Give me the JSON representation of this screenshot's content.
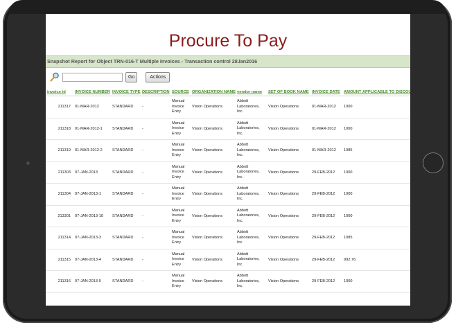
{
  "header": {
    "title": "Procure To Pay"
  },
  "report": {
    "title": "Snapshot Report for Object TRN-016-T Multiple invoices - Transaction control 28Jan2016"
  },
  "toolbar": {
    "go_label": "Go",
    "actions_label": "Actions"
  },
  "table": {
    "columns": [
      "invoice id",
      "INVOICE NUMBER",
      "INVOICE TYPE",
      "DESCRIPTION",
      "SOURCE",
      "ORGANIZATION NAME",
      "vendor name",
      "SET OF BOOK NAME",
      "INVOICE DATE",
      "AMOUNT APPLICABLE TO DISCOUN"
    ],
    "rows": [
      {
        "invoice_id": "211317",
        "invoice_number": "01-MAR-2012",
        "invoice_type": "STANDARD",
        "description": "-",
        "source_l1": "Manual",
        "source_l2": "Invoice",
        "source_l3": "Entry",
        "org": "Vision Operations",
        "vendor_l1": "Abbott",
        "vendor_l2": "Laboratories, Inc.",
        "sob": "Vision Operations",
        "invoice_date": "01-MAR-2012",
        "amount": "1000"
      },
      {
        "invoice_id": "211318",
        "invoice_number": "01-MAR-2012-1",
        "invoice_type": "STANDARD",
        "description": "-",
        "source_l1": "Manual",
        "source_l2": "Invoice",
        "source_l3": "Entry",
        "org": "Vision Operations",
        "vendor_l1": "Abbott",
        "vendor_l2": "Laboratories, Inc.",
        "sob": "Vision Operations",
        "invoice_date": "01-MAR-2012",
        "amount": "1000"
      },
      {
        "invoice_id": "211319",
        "invoice_number": "01-MAR-2012-2",
        "invoice_type": "STANDARD",
        "description": "-",
        "source_l1": "Manual",
        "source_l2": "Invoice",
        "source_l3": "Entry",
        "org": "Vision Operations",
        "vendor_l1": "Abbott",
        "vendor_l2": "Laboratories, Inc.",
        "sob": "Vision Operations",
        "invoice_date": "01-MAR-2012",
        "amount": "1085"
      },
      {
        "invoice_id": "211303",
        "invoice_number": "07-JAN-2013",
        "invoice_type": "STANDARD",
        "description": "-",
        "source_l1": "Manual",
        "source_l2": "Invoice",
        "source_l3": "Entry",
        "org": "Vision Operations",
        "vendor_l1": "Abbott",
        "vendor_l2": "Laboratories, Inc.",
        "sob": "Vision Operations",
        "invoice_date": "29-FEB-2012",
        "amount": "1000"
      },
      {
        "invoice_id": "211304",
        "invoice_number": "07-JAN-2013-1",
        "invoice_type": "STANDARD",
        "description": "-",
        "source_l1": "Manual",
        "source_l2": "Invoice",
        "source_l3": "Entry",
        "org": "Vision Operations",
        "vendor_l1": "Abbott",
        "vendor_l2": "Laboratories, Inc.",
        "sob": "Vision Operations",
        "invoice_date": "29-FEB-2012",
        "amount": "1000"
      },
      {
        "invoice_id": "213301",
        "invoice_number": "07-JAN-2013-10",
        "invoice_type": "STANDARD",
        "description": "-",
        "source_l1": "Manual",
        "source_l2": "Invoice",
        "source_l3": "Entry",
        "org": "Vision Operations",
        "vendor_l1": "Abbott",
        "vendor_l2": "Laboratories, Inc.",
        "sob": "Vision Operations",
        "invoice_date": "29-FEB-2012",
        "amount": "1000"
      },
      {
        "invoice_id": "211314",
        "invoice_number": "07-JAN-2013-3",
        "invoice_type": "STANDARD",
        "description": "-",
        "source_l1": "Manual",
        "source_l2": "Invoice",
        "source_l3": "Entry",
        "org": "Vision Operations",
        "vendor_l1": "Abbott",
        "vendor_l2": "Laboratories, Inc.",
        "sob": "Vision Operations",
        "invoice_date": "29-FEB-2012",
        "amount": "1085"
      },
      {
        "invoice_id": "211315",
        "invoice_number": "07-JAN-2013-4",
        "invoice_type": "STANDARD",
        "description": "-",
        "source_l1": "Manual",
        "source_l2": "Invoice",
        "source_l3": "Entry",
        "org": "Vision Operations",
        "vendor_l1": "Abbott",
        "vendor_l2": "Laboratories, Inc.",
        "sob": "Vision Operations",
        "invoice_date": "29-FEB-2012",
        "amount": "992.76"
      },
      {
        "invoice_id": "211316",
        "invoice_number": "07-JAN-2013-5",
        "invoice_type": "STANDARD",
        "description": "-",
        "source_l1": "Manual",
        "source_l2": "Invoice",
        "source_l3": "Entry",
        "org": "Vision Operations",
        "vendor_l1": "Abbott",
        "vendor_l2": "Laboratories, Inc.",
        "sob": "Vision Operations",
        "invoice_date": "29-FEB-2012",
        "amount": "1000"
      }
    ]
  }
}
